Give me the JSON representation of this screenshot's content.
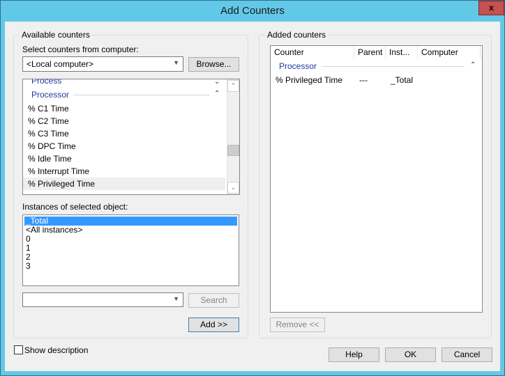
{
  "window": {
    "title": "Add Counters",
    "close_label": "x"
  },
  "available": {
    "group_label": "Available counters",
    "select_label": "Select counters from computer:",
    "computer_value": "<Local computer>",
    "browse_label": "Browse...",
    "categories": [
      {
        "name": "Process",
        "state": "collapsed"
      },
      {
        "name": "Processor",
        "state": "expanded"
      }
    ],
    "counters": [
      "% C1 Time",
      "% C2 Time",
      "% C3 Time",
      "% DPC Time",
      "% Idle Time",
      "% Interrupt Time",
      "% Privileged Time"
    ],
    "highlighted_counter": "% Privileged Time",
    "instances_label": "Instances of selected object:",
    "instances": [
      "_Total",
      "<All instances>",
      "0",
      "1",
      "2",
      "3"
    ],
    "selected_instance": "_Total",
    "search_value": "",
    "search_label": "Search",
    "add_label": "Add >>"
  },
  "added": {
    "group_label": "Added counters",
    "columns": [
      "Counter",
      "Parent",
      "Inst...",
      "Computer"
    ],
    "group_name": "Processor",
    "rows": [
      {
        "counter": "% Privileged Time",
        "parent": "---",
        "instance": "_Total",
        "computer": ""
      }
    ],
    "remove_label": "Remove <<"
  },
  "footer": {
    "show_description_label": "Show description",
    "show_description_checked": false,
    "help_label": "Help",
    "ok_label": "OK",
    "cancel_label": "Cancel"
  },
  "colors": {
    "titlebar": "#62c8e8",
    "close": "#c75050",
    "selection": "#3399ff",
    "category_text": "#1e3a9e"
  }
}
